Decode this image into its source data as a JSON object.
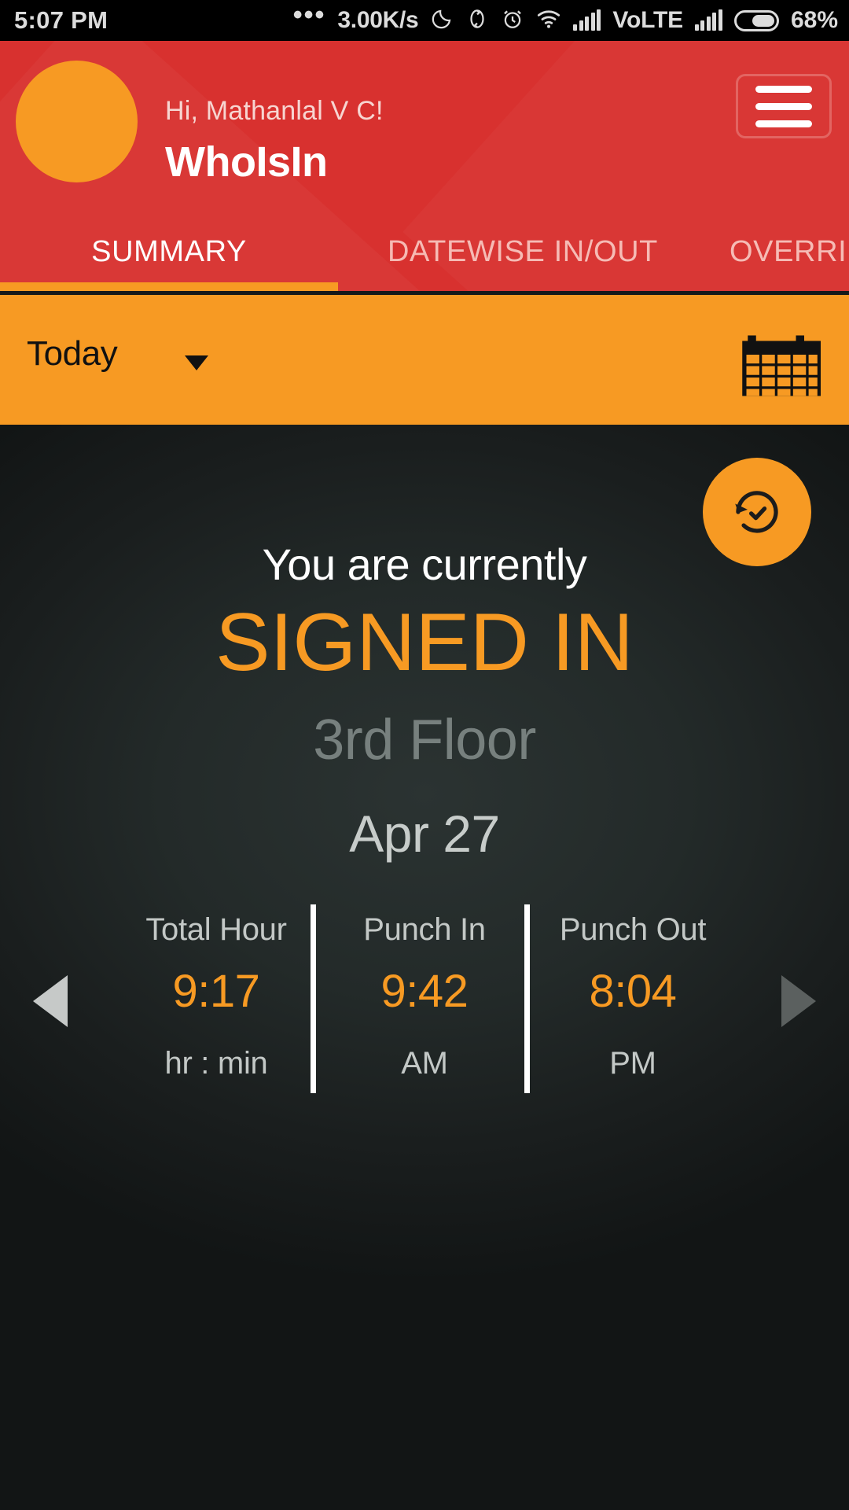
{
  "statusbar": {
    "time": "5:07 PM",
    "dots": "•••",
    "network_speed": "3.00K/s",
    "moon_icon": "do-not-disturb-icon",
    "sync_icon": "sync-icon",
    "alarm_icon": "alarm-icon",
    "wifi_icon": "wifi-icon",
    "signal_icon": "signal-bars-icon",
    "volte": "VoLTE",
    "battery_percent": "68%"
  },
  "header": {
    "greeting": "Hi, Mathanlal V C!",
    "app_title": "WhoIsIn",
    "menu_icon": "hamburger-menu-icon",
    "avatar": "user-avatar",
    "background_color": "#d8312f",
    "accent_color": "#f79a23"
  },
  "tabs": [
    {
      "label": "SUMMARY",
      "active": true
    },
    {
      "label": "DATEWISE IN/OUT",
      "active": false
    },
    {
      "label": "OVERRIDE",
      "active": false
    }
  ],
  "filterbar": {
    "selected_range": "Today",
    "dropdown_icon": "chevron-down-icon",
    "calendar_icon": "calendar-icon",
    "background_color": "#f79a23"
  },
  "main": {
    "refresh_icon": "history-clock-icon",
    "status_prefix": "You are currently",
    "status_state": "SIGNED IN",
    "location": "3rd Floor",
    "date": "Apr 27",
    "state_color": "#f79a23",
    "prev_arrow_icon": "chevron-left-icon",
    "next_arrow_icon": "chevron-right-icon"
  },
  "stats": [
    {
      "title": "Total Hour",
      "value": "9:17",
      "unit": "hr : min"
    },
    {
      "title": "Punch In",
      "value": "9:42",
      "unit": "AM"
    },
    {
      "title": "Punch Out",
      "value": "8:04",
      "unit": "PM"
    }
  ]
}
